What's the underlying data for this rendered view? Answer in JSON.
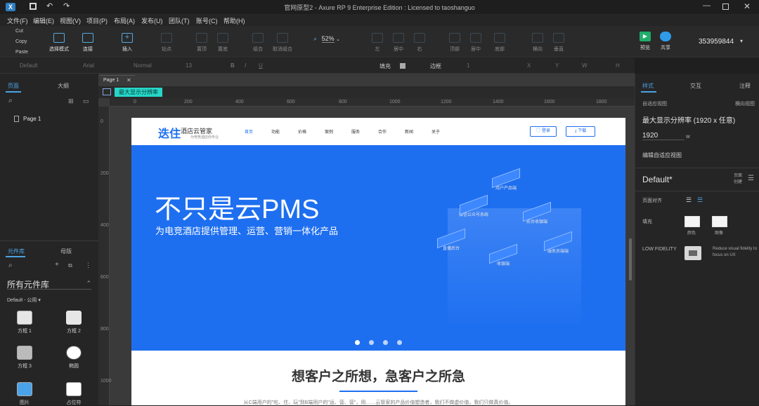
{
  "window": {
    "title": "官网原型2 - Axure RP 9 Enterprise Edition : Licensed to taoshanguo"
  },
  "menu": [
    "文件(F)",
    "编辑(E)",
    "视图(V)",
    "项目(P)",
    "布局(A)",
    "发布(U)",
    "团队(T)",
    "账号(C)",
    "帮助(H)"
  ],
  "clipboard": {
    "cut": "Cut",
    "copy": "Copy",
    "paste": "Paste"
  },
  "toolbar": {
    "select_mode": "选择模式",
    "connect": "连接",
    "insert": "插入",
    "point": "钻点",
    "top": "置顶",
    "bottom": "置底",
    "group": "组合",
    "ungroup": "取消组合",
    "zoom": "52%",
    "left": "左",
    "center": "居中",
    "right": "右",
    "t": "顶部",
    "mid": "居中",
    "b": "底部",
    "hd": "横向",
    "vd": "垂直",
    "preview": "预览",
    "share": "共享",
    "account": "353959844"
  },
  "format": {
    "style": "Default",
    "font": "Arial",
    "weight": "Normal",
    "size": "13",
    "fill": "填充",
    "border": "边框",
    "border_w": "1",
    "x": "X",
    "y": "Y",
    "w": "W",
    "h": "H"
  },
  "left": {
    "tab_pages": "页面",
    "tab_outline": "大纲",
    "page_item": "Page 1",
    "tab_lib": "元件库",
    "tab_master": "母版",
    "lib_select": "所有元件库",
    "lib_group": "Default - 公用 ▾",
    "items": [
      "方框 1",
      "方框 2",
      "方框 3",
      "椭圆",
      "图片",
      "占位符"
    ]
  },
  "canvas": {
    "tab": "Page 1",
    "breakpoint": "最大显示分辨率",
    "ruler_h": [
      "0",
      "200",
      "400",
      "600",
      "800",
      "1000",
      "1200",
      "1400",
      "1600",
      "1800"
    ],
    "ruler_v": [
      "0",
      "200",
      "400",
      "600",
      "800",
      "1000"
    ]
  },
  "site": {
    "logo": "迭住",
    "brand": "酒店云管家",
    "brand_sub": "为电竞酒店而专业",
    "nav": [
      "首页",
      "功能",
      "价格",
      "案例",
      "服务",
      "合作",
      "新闻",
      "关于"
    ],
    "login": "登录",
    "download": "下载",
    "hero_title": "不只是云PMS",
    "hero_sub": "为电竞酒店提供管理、运营、营销一体化产品",
    "cards": [
      "用户产品端",
      "微信公众号系统",
      "前台收银端",
      "直播后台",
      "收银端",
      "服务员端端"
    ],
    "section_title": "想客户之所想，急客户之所急",
    "section_text": "从C端用户的\"吃、住、玩\"到B端用户的\"运、营、营\"，用……云管家的产品价值塑造者，我们不做虚价值，我们只做真价值。"
  },
  "right": {
    "tab_style": "样式",
    "tab_interact": "交互",
    "tab_notes": "注释",
    "adaptive": "自适应视图",
    "view_label": "横向视图",
    "view_name": "最大显示分辨率 (1920 x 任意)",
    "width": "1920",
    "w": "w",
    "edit_adaptive": "编辑自适应视图",
    "style_name": "Default*",
    "page_style": "页面\n创建",
    "align": "页面对齐",
    "fill": "填充",
    "color": "颜色",
    "image": "图像",
    "low_fidelity": "LOW FIDELITY",
    "low_desc": "Reduce visual fidelity to focus on UX"
  },
  "colors": {
    "accent": "#4ba3e3",
    "banner": "#1e6ff0",
    "breakpoint": "#26d7c8"
  }
}
